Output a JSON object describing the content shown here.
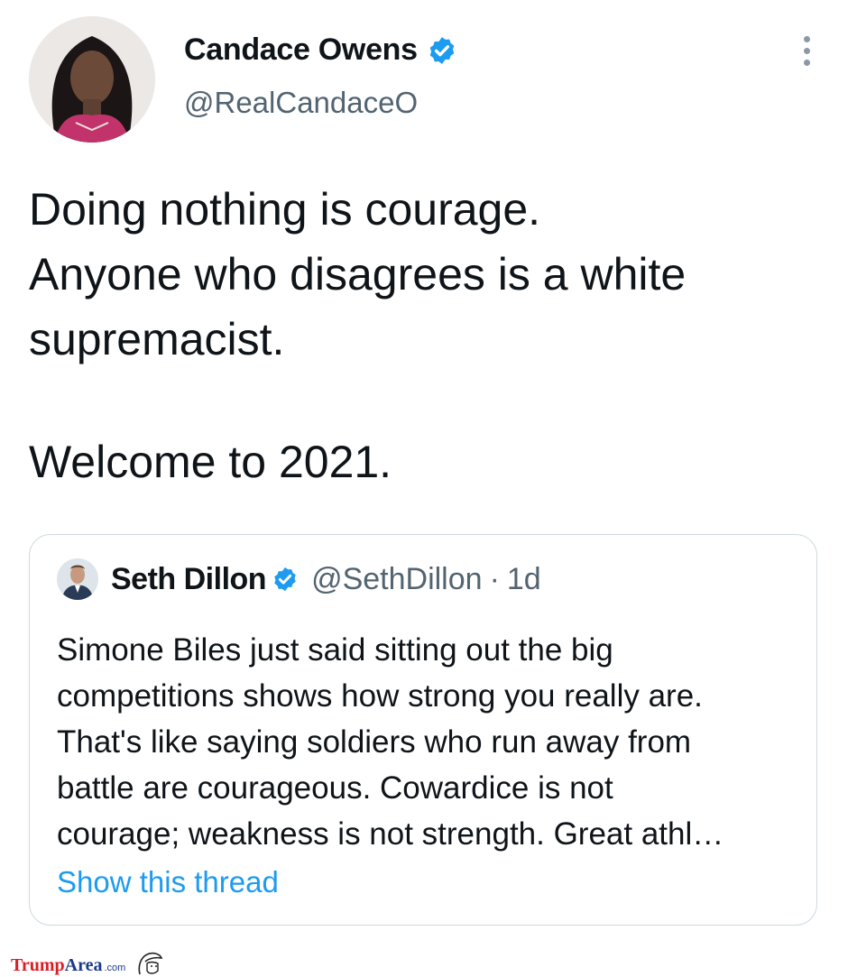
{
  "tweet": {
    "author_name": "Candace Owens",
    "author_handle": "@RealCandaceO",
    "lines": [
      "Doing nothing is courage.",
      "Anyone who disagrees is a white",
      "supremacist."
    ],
    "closing": "Welcome to 2021."
  },
  "quoted_tweet": {
    "author_name": "Seth Dillon",
    "author_handle": "@SethDillon",
    "separator": "·",
    "time": "1d",
    "lines": [
      "Simone Biles just said sitting out the big",
      "competitions shows how strong you really are.",
      "That's like saying soldiers who run away from",
      "battle are courageous. Cowardice is not",
      "courage; weakness is not strength. Great athl…"
    ],
    "show_thread": "Show this thread"
  },
  "watermark": {
    "part1": "Trump",
    "part2": "Area",
    "part3": ".com"
  },
  "colors": {
    "verified_blue": "#1d9bf0",
    "text_primary": "#0f1419",
    "text_secondary": "#536471",
    "border": "#cfd9de"
  },
  "icons": {
    "verified": "verified-badge-icon",
    "more": "more-vertical-icon"
  }
}
